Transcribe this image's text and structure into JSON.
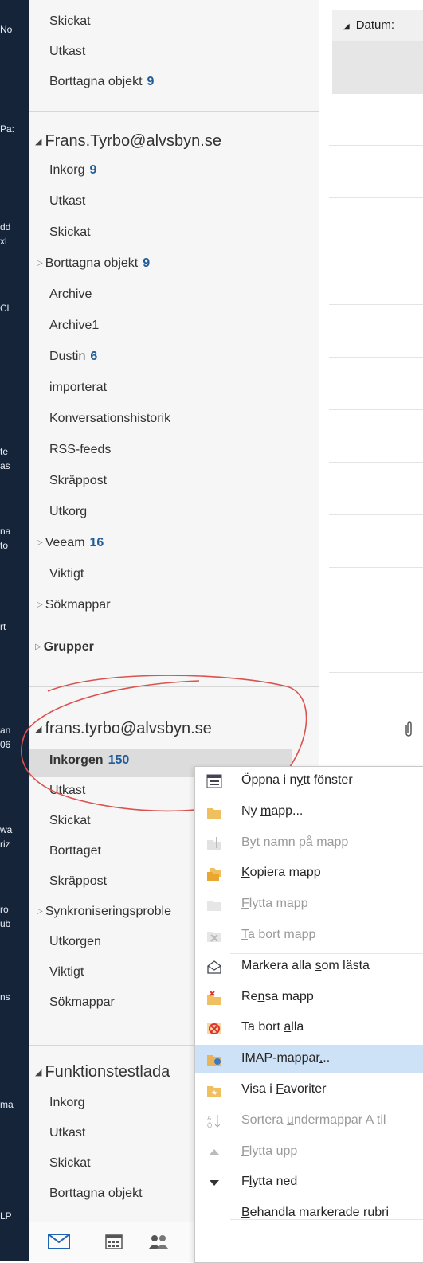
{
  "colors": {
    "count_blue": "#1f5c99",
    "accent": "#1f63b3",
    "highlight": "#cde2f7",
    "annotation": "#d9534f"
  },
  "desktop": {
    "labels": [
      "No",
      "Pa:",
      "dd",
      "xl",
      "Cl",
      "te",
      "as",
      "na",
      "to",
      "rt",
      "an",
      "06",
      "wa",
      "riz",
      "ro",
      "ub",
      "ns",
      "ma",
      "LP"
    ]
  },
  "folder_pane": {
    "top_items": [
      {
        "label": "Skickat",
        "count": ""
      },
      {
        "label": "Utkast",
        "count": ""
      },
      {
        "label": "Borttagna objekt",
        "count": "9"
      }
    ],
    "account1": {
      "name": "Frans.Tyrbo@alvsbyn.se",
      "folders": [
        {
          "label": "Inkorg",
          "count": "9",
          "expand": ""
        },
        {
          "label": "Utkast",
          "count": "",
          "expand": ""
        },
        {
          "label": "Skickat",
          "count": "",
          "expand": ""
        },
        {
          "label": "Borttagna objekt",
          "count": "9",
          "expand": "▷"
        },
        {
          "label": "Archive",
          "count": "",
          "expand": ""
        },
        {
          "label": "Archive1",
          "count": "",
          "expand": ""
        },
        {
          "label": "Dustin",
          "count": "6",
          "expand": ""
        },
        {
          "label": "importerat",
          "count": "",
          "expand": ""
        },
        {
          "label": "Konversationshistorik",
          "count": "",
          "expand": ""
        },
        {
          "label": "RSS-feeds",
          "count": "",
          "expand": ""
        },
        {
          "label": "Skräppost",
          "count": "",
          "expand": ""
        },
        {
          "label": "Utkorg",
          "count": "",
          "expand": ""
        },
        {
          "label": "Veeam",
          "count": "16",
          "expand": "▷"
        },
        {
          "label": "Viktigt",
          "count": "",
          "expand": ""
        },
        {
          "label": "Sökmappar",
          "count": "",
          "expand": "▷"
        }
      ]
    },
    "groups": {
      "label": "Grupper",
      "expand": "▷"
    },
    "account2": {
      "name": "frans.tyrbo@alvsbyn.se",
      "folders": [
        {
          "label": "Inkorgen",
          "count": "150",
          "expand": ""
        },
        {
          "label": "Utkast",
          "count": "",
          "expand": ""
        },
        {
          "label": "Skickat",
          "count": "",
          "expand": ""
        },
        {
          "label": "Borttaget",
          "count": "",
          "expand": ""
        },
        {
          "label": "Skräppost",
          "count": "",
          "expand": ""
        },
        {
          "label": "Synkroniseringsproble",
          "count": "",
          "expand": "▷"
        },
        {
          "label": "Utkorgen",
          "count": "",
          "expand": ""
        },
        {
          "label": "Viktigt",
          "count": "",
          "expand": ""
        },
        {
          "label": "Sökmappar",
          "count": "",
          "expand": ""
        }
      ]
    },
    "account3": {
      "name": "Funktionstestlada",
      "folders": [
        {
          "label": "Inkorg"
        },
        {
          "label": "Utkast"
        },
        {
          "label": "Skickat"
        },
        {
          "label": "Borttagna objekt"
        }
      ]
    },
    "scroll_up": "▲"
  },
  "nav": {
    "icons": [
      "mail-icon",
      "calendar-icon",
      "people-icon"
    ]
  },
  "message_list": {
    "column_header": "Datum:"
  },
  "context_menu": {
    "items": [
      {
        "pre": "Öppna i n",
        "u": "y",
        "post": "tt fönster",
        "icon": "new-window-icon",
        "disabled": false,
        "highlight": false
      },
      {
        "pre": "Ny ",
        "u": "m",
        "post": "app...",
        "icon": "new-folder-icon",
        "disabled": false,
        "highlight": false
      },
      {
        "pre": "",
        "u": "B",
        "post": "yt namn på mapp",
        "icon": "rename-folder-icon",
        "disabled": true,
        "highlight": false
      },
      {
        "pre": "",
        "u": "K",
        "post": "opiera mapp",
        "icon": "copy-folder-icon",
        "disabled": false,
        "highlight": false
      },
      {
        "pre": "",
        "u": "F",
        "post": "lytta mapp",
        "icon": "move-folder-icon",
        "disabled": true,
        "highlight": false
      },
      {
        "pre": "",
        "u": "T",
        "post": "a bort mapp",
        "icon": "delete-folder-icon",
        "disabled": true,
        "highlight": false
      },
      {
        "pre": "Markera alla ",
        "u": "s",
        "post": "om lästa",
        "icon": "mark-read-icon",
        "disabled": false,
        "highlight": false
      },
      {
        "pre": "Re",
        "u": "n",
        "post": "sa mapp",
        "icon": "clean-folder-icon",
        "disabled": false,
        "highlight": false
      },
      {
        "pre": "Ta bort ",
        "u": "a",
        "post": "lla",
        "icon": "delete-all-icon",
        "disabled": false,
        "highlight": false
      },
      {
        "pre": "IMAP-mappar",
        "u": ".",
        "post": "..",
        "icon": "imap-folders-icon",
        "disabled": false,
        "highlight": true
      },
      {
        "pre": "Visa i ",
        "u": "F",
        "post": "avoriter",
        "icon": "favorites-icon",
        "disabled": false,
        "highlight": false
      },
      {
        "pre": "Sortera ",
        "u": "u",
        "post": "ndermappar A til",
        "icon": "sort-az-icon",
        "disabled": true,
        "highlight": false
      },
      {
        "pre": "",
        "u": "F",
        "post": "lytta upp",
        "icon": "move-up-icon",
        "disabled": true,
        "highlight": false
      },
      {
        "pre": "F",
        "u": "l",
        "post": "ytta ned",
        "icon": "move-down-icon",
        "disabled": false,
        "highlight": false
      },
      {
        "pre": "",
        "u": "B",
        "post": "ehandla markerade rubri",
        "icon": "process-headers-icon",
        "disabled": false,
        "highlight": false
      }
    ]
  }
}
